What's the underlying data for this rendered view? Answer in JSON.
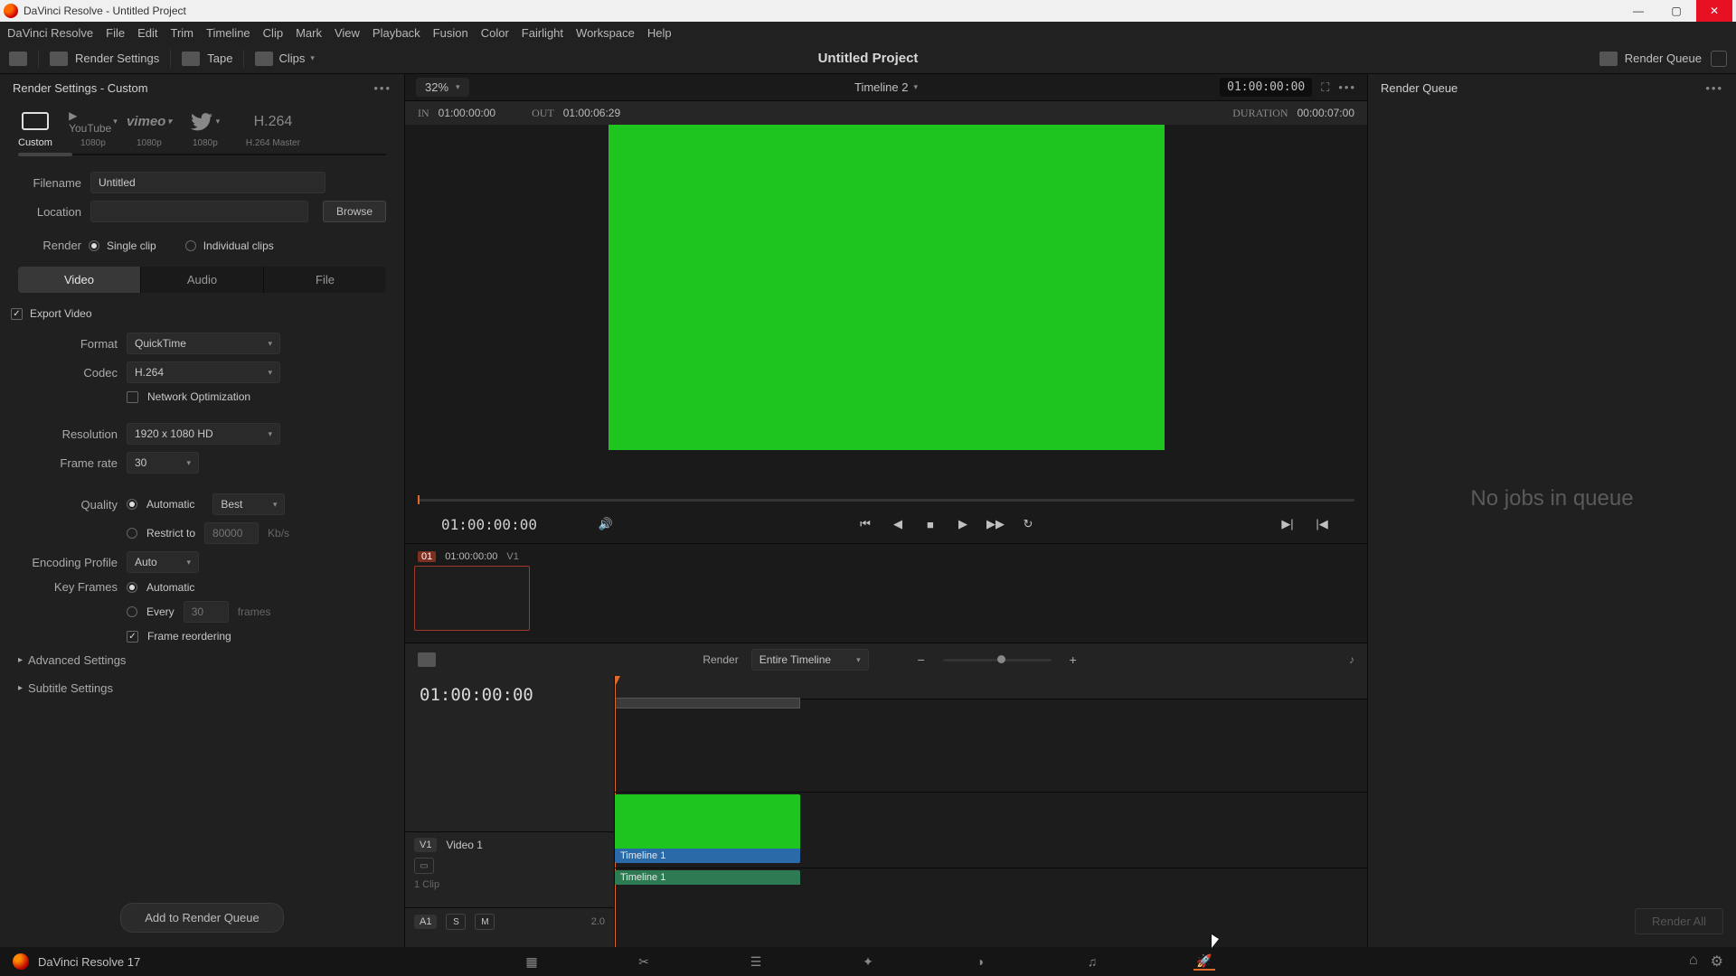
{
  "window": {
    "title": "DaVinci Resolve - Untitled Project"
  },
  "menu": [
    "DaVinci Resolve",
    "File",
    "Edit",
    "Trim",
    "Timeline",
    "Clip",
    "Mark",
    "View",
    "Playback",
    "Fusion",
    "Color",
    "Fairlight",
    "Workspace",
    "Help"
  ],
  "toolbar": {
    "render_settings": "Render Settings",
    "tape": "Tape",
    "clips": "Clips",
    "project_title": "Untitled Project",
    "render_queue_btn": "Render Queue"
  },
  "left": {
    "header": "Render Settings - Custom",
    "presets": [
      {
        "name": "Custom",
        "sub": ""
      },
      {
        "name": "YouTube",
        "sub": "1080p",
        "brand": "▶ YouTube"
      },
      {
        "name": "vimeo",
        "sub": "1080p"
      },
      {
        "name": "Twitter",
        "sub": "1080p"
      },
      {
        "name": "H.264",
        "sub": "H.264 Master"
      }
    ],
    "filename_lbl": "Filename",
    "filename_val": "Untitled",
    "location_lbl": "Location",
    "location_val": "",
    "browse": "Browse",
    "render_lbl": "Render",
    "single_clip": "Single clip",
    "individual_clips": "Individual clips",
    "tabs": [
      "Video",
      "Audio",
      "File"
    ],
    "export_video": "Export Video",
    "format_lbl": "Format",
    "format_val": "QuickTime",
    "codec_lbl": "Codec",
    "codec_val": "H.264",
    "network_opt": "Network Optimization",
    "resolution_lbl": "Resolution",
    "resolution_val": "1920 x 1080 HD",
    "framerate_lbl": "Frame rate",
    "framerate_val": "30",
    "quality_lbl": "Quality",
    "quality_auto": "Automatic",
    "quality_best": "Best",
    "quality_restrict": "Restrict to",
    "quality_restrict_val": "80000",
    "quality_restrict_unit": "Kb/s",
    "encprofile_lbl": "Encoding Profile",
    "encprofile_val": "Auto",
    "keyframes_lbl": "Key Frames",
    "keyframes_auto": "Automatic",
    "keyframes_every": "Every",
    "keyframes_every_val": "30",
    "keyframes_every_unit": "frames",
    "frame_reorder": "Frame reordering",
    "advanced": "Advanced Settings",
    "subtitle": "Subtitle Settings",
    "add_to_queue": "Add to Render Queue"
  },
  "viewer": {
    "zoom": "32%",
    "timeline_name": "Timeline 2",
    "tc_right": "01:00:00:00",
    "in_lbl": "IN",
    "in_tc": "01:00:00:00",
    "out_lbl": "OUT",
    "out_tc": "01:00:06:29",
    "dur_lbl": "DURATION",
    "dur_tc": "00:00:07:00",
    "transport_tc": "01:00:00:00",
    "thumb_idx": "01",
    "thumb_tc": "01:00:00:00",
    "thumb_track": "V1"
  },
  "tl_toolbar": {
    "render_lbl": "Render",
    "render_range": "Entire Timeline"
  },
  "timeline": {
    "big_tc": "01:00:00:00",
    "v1": {
      "tag": "V1",
      "name": "Video 1",
      "clip_count": "1 Clip"
    },
    "a1": {
      "tag": "A1",
      "s": "S",
      "m": "M",
      "level": "2.0"
    },
    "clip_name": "Timeline 1"
  },
  "right": {
    "header": "Render Queue",
    "empty": "No jobs in queue",
    "render_all": "Render All"
  },
  "footer": {
    "app": "DaVinci Resolve 17"
  }
}
